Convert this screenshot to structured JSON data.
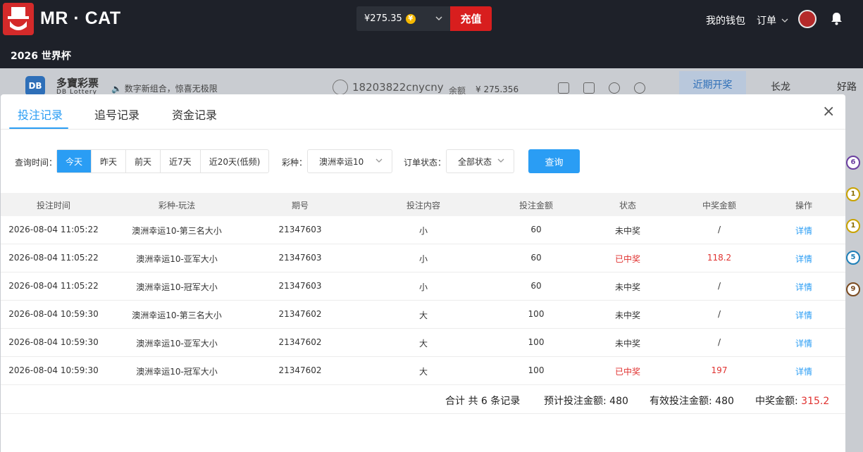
{
  "header": {
    "brand": "MR · CAT",
    "balance": "¥275.35",
    "coin_symbol": "¥",
    "recharge_label": "充值",
    "wallet_label": "我的钱包",
    "order_label": "订单",
    "sub_title": "2026 世界杯"
  },
  "lottery_page": {
    "logo_short": "DB",
    "logo_title": "多寶彩票",
    "logo_sub": "DB Lottery",
    "slogan": "数字新组合，惊喜无极限",
    "username": "18203822cnycny",
    "balance_label": "余额",
    "balance_value": "¥ 275.356",
    "tabs": [
      "近期开奖",
      "长龙",
      "好路"
    ],
    "side_balls": [
      "6",
      "1",
      "1",
      "5",
      "9"
    ]
  },
  "modal": {
    "tabs": [
      "投注记录",
      "追号记录",
      "资金记录"
    ],
    "active_tab": 0,
    "close_symbol": "×",
    "filters": {
      "time_label": "查询时间：",
      "date_options": [
        "今天",
        "昨天",
        "前天",
        "近7天",
        "近20天(低频)"
      ],
      "active_date": 0,
      "lottery_label": "彩种：",
      "lottery_value": "澳洲幸运10",
      "status_label": "订单状态：",
      "status_value": "全部状态",
      "query_label": "查询"
    },
    "columns": [
      "投注时间",
      "彩种-玩法",
      "期号",
      "投注内容",
      "投注金额",
      "状态",
      "中奖金额",
      "操作"
    ],
    "rows": [
      {
        "time": "2026-08-04 11:05:22",
        "game": "澳洲幸运10-第三名大小",
        "issue": "21347603",
        "content": "小",
        "amount": "60",
        "status": "未中奖",
        "won": false,
        "prize": "/",
        "action": "详情"
      },
      {
        "time": "2026-08-04 11:05:22",
        "game": "澳洲幸运10-亚军大小",
        "issue": "21347603",
        "content": "小",
        "amount": "60",
        "status": "已中奖",
        "won": true,
        "prize": "118.2",
        "action": "详情"
      },
      {
        "time": "2026-08-04 11:05:22",
        "game": "澳洲幸运10-冠军大小",
        "issue": "21347603",
        "content": "小",
        "amount": "60",
        "status": "未中奖",
        "won": false,
        "prize": "/",
        "action": "详情"
      },
      {
        "time": "2026-08-04 10:59:30",
        "game": "澳洲幸运10-第三名大小",
        "issue": "21347602",
        "content": "大",
        "amount": "100",
        "status": "未中奖",
        "won": false,
        "prize": "/",
        "action": "详情"
      },
      {
        "time": "2026-08-04 10:59:30",
        "game": "澳洲幸运10-亚军大小",
        "issue": "21347602",
        "content": "大",
        "amount": "100",
        "status": "未中奖",
        "won": false,
        "prize": "/",
        "action": "详情"
      },
      {
        "time": "2026-08-04 10:59:30",
        "game": "澳洲幸运10-冠军大小",
        "issue": "21347602",
        "content": "大",
        "amount": "100",
        "status": "已中奖",
        "won": true,
        "prize": "197",
        "action": "详情"
      }
    ],
    "summary": {
      "total_text": "合计 共 6 条记录",
      "expected_label": "预计投注金额:",
      "expected_value": "480",
      "valid_label": "有效投注金额:",
      "valid_value": "480",
      "prize_label": "中奖金额:",
      "prize_value": "315.2"
    }
  },
  "colors": {
    "accent_blue": "#2a9df4",
    "win_red": "#e0312f",
    "recharge_red": "#d81e1e",
    "topbar_bg": "#1e2129"
  }
}
